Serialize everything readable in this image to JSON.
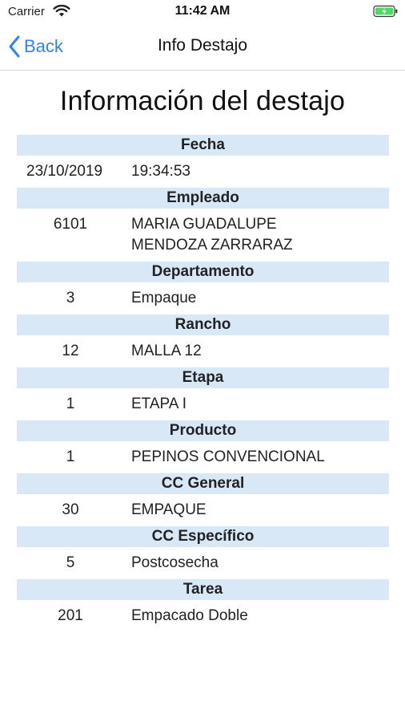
{
  "status_bar": {
    "carrier": "Carrier",
    "time": "11:42 AM",
    "wifi_icon": "wifi-icon",
    "battery_icon": "battery-charging-icon",
    "battery_color": "#4cd964"
  },
  "nav": {
    "back_label": "Back",
    "title": "Info Destajo",
    "accent": "#2d84f5"
  },
  "page_title": "Información del destajo",
  "header_bg": "#d8e8f7",
  "sections": [
    {
      "header": "Fecha",
      "code": "23/10/2019",
      "desc": "19:34:53"
    },
    {
      "header": "Empleado",
      "code": "6101",
      "desc": "MARIA GUADALUPE MENDOZA ZARRARAZ"
    },
    {
      "header": "Departamento",
      "code": "3",
      "desc": "Empaque"
    },
    {
      "header": "Rancho",
      "code": "12",
      "desc": "MALLA 12"
    },
    {
      "header": "Etapa",
      "code": "1",
      "desc": "ETAPA I"
    },
    {
      "header": "Producto",
      "code": "1",
      "desc": "PEPINOS CONVENCIONAL"
    },
    {
      "header": "CC General",
      "code": "30",
      "desc": "EMPAQUE"
    },
    {
      "header": "CC Específico",
      "code": "5",
      "desc": "Postcosecha"
    },
    {
      "header": "Tarea",
      "code": "201",
      "desc": "Empacado Doble"
    }
  ]
}
